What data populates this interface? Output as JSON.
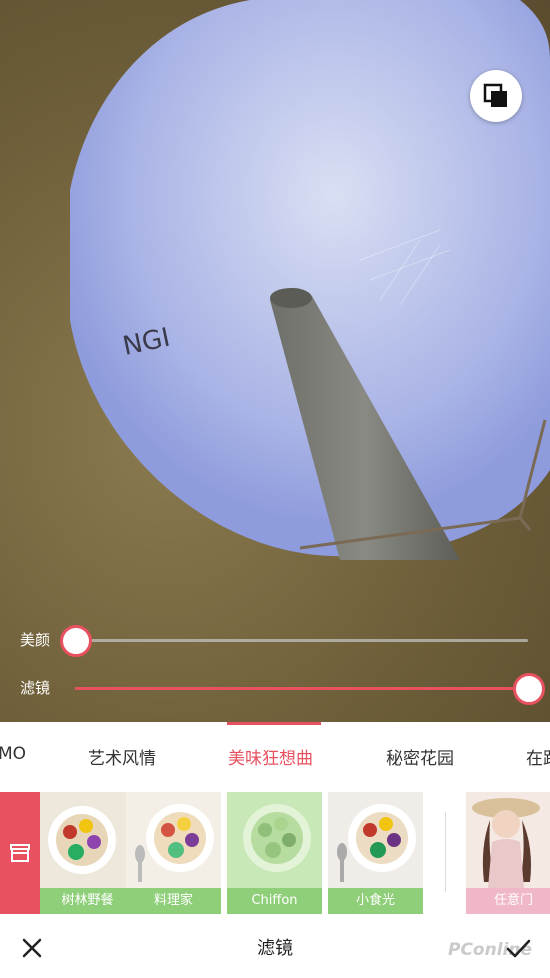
{
  "compare_icon": "compare-icon",
  "sliders": [
    {
      "label": "美颜",
      "value_percent": 0
    },
    {
      "label": "滤镜",
      "value_percent": 100
    }
  ],
  "tabs": [
    {
      "label": "MO",
      "active": false
    },
    {
      "label": "艺术风情",
      "active": false
    },
    {
      "label": "美味狂想曲",
      "active": true
    },
    {
      "label": "秘密花园",
      "active": false
    },
    {
      "label": "在路",
      "active": false
    }
  ],
  "store_icon": "store-icon",
  "filters": [
    {
      "name": "树林野餐",
      "label_color": "#8fcf7a"
    },
    {
      "name": "料理家",
      "label_color": "#8fcf7a"
    },
    {
      "name": "Chiffon",
      "label_color": "#8fcf7a"
    },
    {
      "name": "小食光",
      "label_color": "#8fcf7a"
    },
    {
      "name": "任意门",
      "label_color": "#f0b7c6"
    }
  ],
  "bottom": {
    "title": "滤镜",
    "close_icon": "close-icon",
    "confirm_icon": "checkmark-icon",
    "watermark": "PConline"
  },
  "colors": {
    "accent": "#e8515f",
    "filter_label_green": "#8fcf7a",
    "filter_label_pink": "#f0b7c6"
  }
}
